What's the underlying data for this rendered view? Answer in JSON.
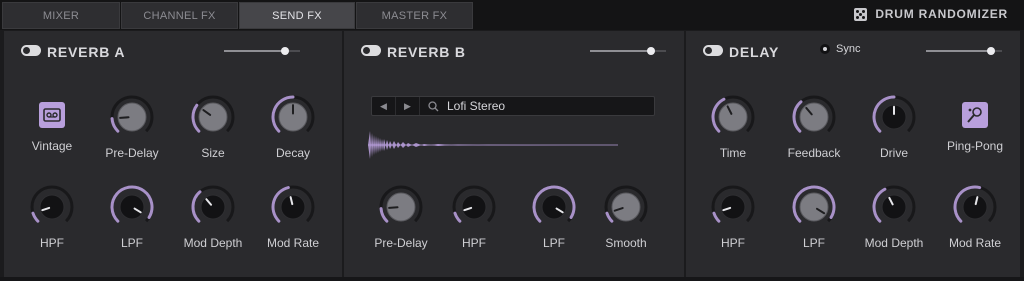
{
  "tabs": [
    {
      "label": "MIXER",
      "active": false
    },
    {
      "label": "CHANNEL FX",
      "active": false
    },
    {
      "label": "SEND FX",
      "active": true
    },
    {
      "label": "MASTER FX",
      "active": false
    }
  ],
  "brand": {
    "label": "DRUM RANDOMIZER",
    "icon": "dice-icon"
  },
  "colors": {
    "accent": "#b89fdc",
    "panel": "#2a2a2d",
    "background": "#1b1b1d"
  },
  "reverb_a": {
    "title": "REVERB A",
    "enabled": true,
    "send_level": 0.8,
    "mode_label": "Vintage",
    "mode_icon": "tape-icon",
    "knobs": {
      "pre_delay": {
        "label": "Pre-Delay",
        "value": 0.15
      },
      "size": {
        "label": "Size",
        "value": 0.3
      },
      "decay": {
        "label": "Decay",
        "value": 0.5
      },
      "hpf": {
        "label": "HPF",
        "value": 0.1
      },
      "lpf": {
        "label": "LPF",
        "value": 0.95
      },
      "mod_depth": {
        "label": "Mod Depth",
        "value": 0.35
      },
      "mod_rate": {
        "label": "Mod Rate",
        "value": 0.45
      }
    }
  },
  "reverb_b": {
    "title": "REVERB B",
    "enabled": true,
    "send_level": 0.8,
    "preset": "Lofi Stereo",
    "knobs": {
      "pre_delay": {
        "label": "Pre-Delay",
        "value": 0.15
      },
      "hpf": {
        "label": "HPF",
        "value": 0.1
      },
      "lpf": {
        "label": "LPF",
        "value": 0.95
      },
      "smooth": {
        "label": "Smooth",
        "value": 0.1
      }
    }
  },
  "delay": {
    "title": "DELAY",
    "enabled": true,
    "sync_label": "Sync",
    "send_level": 0.85,
    "mode_label": "Ping-Pong",
    "mode_icon": "ping-pong-icon",
    "knobs": {
      "time": {
        "label": "Time",
        "value": 0.4
      },
      "feedback": {
        "label": "Feedback",
        "value": 0.35
      },
      "drive": {
        "label": "Drive",
        "value": 0.5
      },
      "hpf": {
        "label": "HPF",
        "value": 0.1
      },
      "lpf": {
        "label": "LPF",
        "value": 0.95
      },
      "mod_depth": {
        "label": "Mod Depth",
        "value": 0.4
      },
      "mod_rate": {
        "label": "Mod Rate",
        "value": 0.55
      }
    }
  }
}
